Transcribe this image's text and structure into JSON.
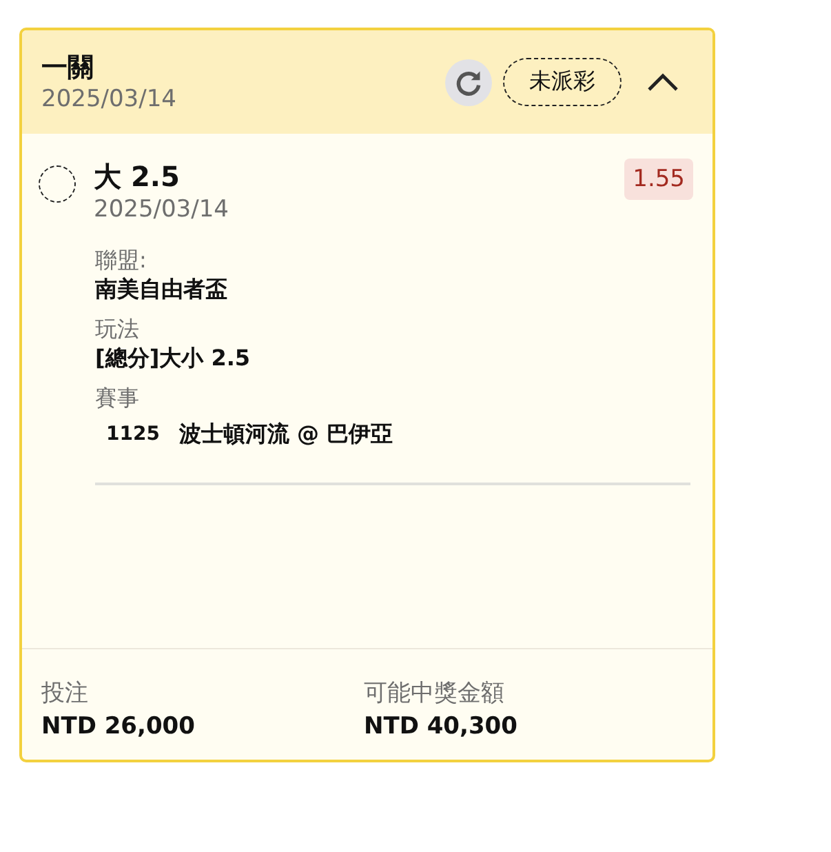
{
  "header": {
    "title": "一關",
    "date": "2025/03/14",
    "status": "未派彩",
    "expanded": true
  },
  "selection": {
    "name": "大 2.5",
    "date": "2025/03/14",
    "odds": "1.55",
    "checked": false
  },
  "details": [
    {
      "kind": "text",
      "label": "聯盟:",
      "value": "南美自由者盃"
    },
    {
      "kind": "text",
      "label": "玩法",
      "value": "[總分]大小 2.5"
    },
    {
      "kind": "match",
      "label": "賽事",
      "number": "1125",
      "value": "波士頓河流 @ 巴伊亞"
    }
  ],
  "footer": [
    {
      "label": "投注",
      "value": "NTD 26,000"
    },
    {
      "label": "可能中獎金額",
      "value": "NTD 40,300"
    }
  ]
}
